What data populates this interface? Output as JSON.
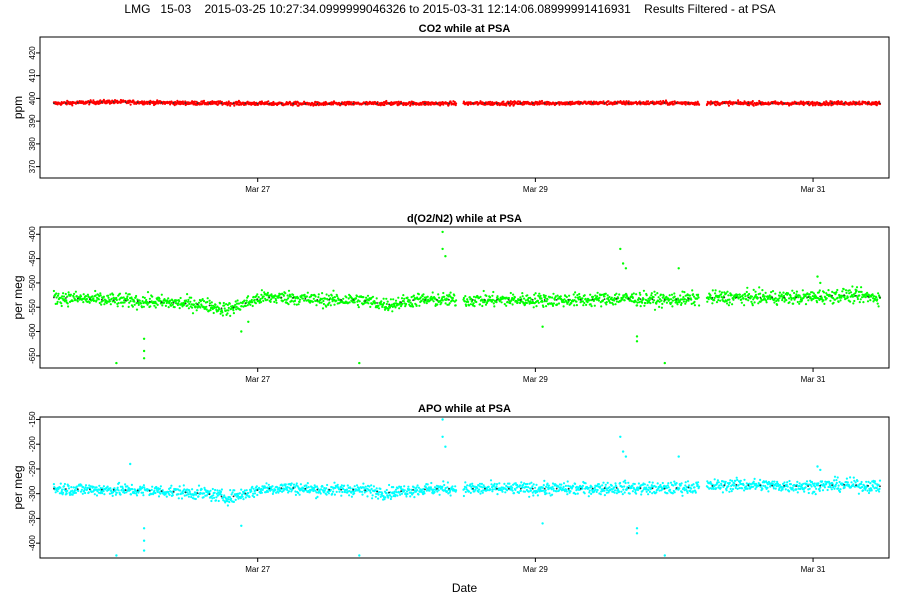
{
  "title": "LMG   15-03    2015-03-25 10:27:34.0999999046326 to 2015-03-31 12:14:06.08999991416931    Results Filtered - at PSA",
  "xlabel": "Date",
  "chart_data": [
    {
      "type": "scatter",
      "title": "CO2 while at PSA",
      "ylabel": "ppm",
      "xlim": [
        0,
        6.115
      ],
      "ylim": [
        365,
        427
      ],
      "yticks": [
        370,
        380,
        390,
        400,
        410,
        420
      ],
      "xticks": [
        {
          "x": 1.568,
          "label": "Mar 27"
        },
        {
          "x": 3.568,
          "label": "Mar 29"
        },
        {
          "x": 5.568,
          "label": "Mar 31"
        }
      ],
      "color": "#ff0000",
      "gaps": [
        [
          3.0,
          3.05
        ],
        [
          4.75,
          4.8
        ]
      ],
      "baseline": [
        [
          0.1,
          397.8
        ],
        [
          0.5,
          398.5
        ],
        [
          1.0,
          398.0
        ],
        [
          1.5,
          397.8
        ],
        [
          2.0,
          397.6
        ],
        [
          2.5,
          397.8
        ],
        [
          3.0,
          397.8
        ],
        [
          3.5,
          397.9
        ],
        [
          4.0,
          398.0
        ],
        [
          4.5,
          398.0
        ],
        [
          5.0,
          397.9
        ],
        [
          5.5,
          397.8
        ],
        [
          5.9,
          398.0
        ],
        [
          6.05,
          397.8
        ]
      ],
      "noise": 0.6,
      "outliers": []
    },
    {
      "type": "scatter",
      "title": "d(O2/N2) while at PSA",
      "ylabel": "per meg",
      "xlim": [
        0,
        6.115
      ],
      "ylim": [
        -675,
        -385
      ],
      "yticks": [
        -650,
        -600,
        -550,
        -500,
        -450,
        -400
      ],
      "xticks": [
        {
          "x": 1.568,
          "label": "Mar 27"
        },
        {
          "x": 3.568,
          "label": "Mar 29"
        },
        {
          "x": 5.568,
          "label": "Mar 31"
        }
      ],
      "color": "#00ff00",
      "gaps": [
        [
          3.0,
          3.05
        ],
        [
          4.75,
          4.8
        ]
      ],
      "baseline": [
        [
          0.1,
          -530
        ],
        [
          0.5,
          -535
        ],
        [
          0.9,
          -540
        ],
        [
          1.2,
          -545
        ],
        [
          1.35,
          -555
        ],
        [
          1.45,
          -545
        ],
        [
          1.6,
          -530
        ],
        [
          1.8,
          -530
        ],
        [
          2.0,
          -535
        ],
        [
          2.3,
          -535
        ],
        [
          2.5,
          -545
        ],
        [
          2.7,
          -535
        ],
        [
          2.9,
          -535
        ],
        [
          3.1,
          -535
        ],
        [
          3.5,
          -535
        ],
        [
          3.9,
          -535
        ],
        [
          4.2,
          -532
        ],
        [
          4.5,
          -535
        ],
        [
          4.9,
          -530
        ],
        [
          5.2,
          -530
        ],
        [
          5.5,
          -530
        ],
        [
          5.8,
          -525
        ],
        [
          6.05,
          -530
        ]
      ],
      "noise": 10,
      "outliers": [
        [
          0.55,
          -665
        ],
        [
          0.75,
          -615
        ],
        [
          0.75,
          -640
        ],
        [
          0.75,
          -655
        ],
        [
          1.45,
          -600
        ],
        [
          1.5,
          -580
        ],
        [
          2.3,
          -665
        ],
        [
          2.9,
          -395
        ],
        [
          2.9,
          -430
        ],
        [
          2.92,
          -445
        ],
        [
          3.62,
          -590
        ],
        [
          4.18,
          -430
        ],
        [
          4.2,
          -460
        ],
        [
          4.22,
          -470
        ],
        [
          4.3,
          -610
        ],
        [
          4.3,
          -620
        ],
        [
          4.5,
          -665
        ],
        [
          4.6,
          -470
        ],
        [
          5.6,
          -487
        ],
        [
          5.62,
          -500
        ]
      ]
    },
    {
      "type": "scatter",
      "title": "APO while at PSA",
      "ylabel": "per meg",
      "xlim": [
        0,
        6.115
      ],
      "ylim": [
        -430,
        -145
      ],
      "yticks": [
        -400,
        -350,
        -300,
        -250,
        -200,
        -150
      ],
      "xticks": [
        {
          "x": 1.568,
          "label": "Mar 27"
        },
        {
          "x": 3.568,
          "label": "Mar 29"
        },
        {
          "x": 5.568,
          "label": "Mar 31"
        }
      ],
      "color": "#00ffff",
      "gaps": [
        [
          3.0,
          3.05
        ],
        [
          4.75,
          4.8
        ]
      ],
      "baseline": [
        [
          0.1,
          -290
        ],
        [
          0.5,
          -292
        ],
        [
          0.9,
          -295
        ],
        [
          1.2,
          -300
        ],
        [
          1.35,
          -308
        ],
        [
          1.45,
          -302
        ],
        [
          1.6,
          -290
        ],
        [
          1.8,
          -288
        ],
        [
          2.0,
          -292
        ],
        [
          2.3,
          -292
        ],
        [
          2.5,
          -298
        ],
        [
          2.7,
          -292
        ],
        [
          2.9,
          -290
        ],
        [
          3.1,
          -290
        ],
        [
          3.5,
          -290
        ],
        [
          3.9,
          -290
        ],
        [
          4.2,
          -288
        ],
        [
          4.5,
          -290
        ],
        [
          4.8,
          -285
        ],
        [
          5.0,
          -282
        ],
        [
          5.5,
          -285
        ],
        [
          5.8,
          -282
        ],
        [
          6.05,
          -285
        ]
      ],
      "noise": 9,
      "outliers": [
        [
          0.55,
          -425
        ],
        [
          0.65,
          -240
        ],
        [
          0.75,
          -370
        ],
        [
          0.75,
          -395
        ],
        [
          0.75,
          -415
        ],
        [
          1.45,
          -365
        ],
        [
          2.3,
          -425
        ],
        [
          2.9,
          -150
        ],
        [
          2.9,
          -185
        ],
        [
          2.92,
          -205
        ],
        [
          3.62,
          -360
        ],
        [
          4.18,
          -185
        ],
        [
          4.2,
          -215
        ],
        [
          4.22,
          -225
        ],
        [
          4.3,
          -370
        ],
        [
          4.3,
          -380
        ],
        [
          4.5,
          -425
        ],
        [
          4.6,
          -225
        ],
        [
          5.6,
          -245
        ],
        [
          5.62,
          -252
        ]
      ]
    }
  ]
}
